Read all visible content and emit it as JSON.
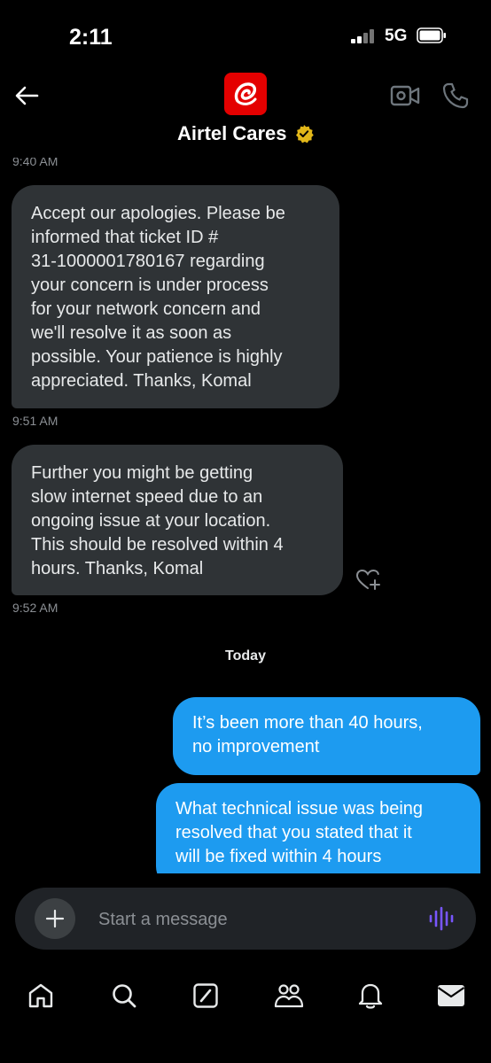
{
  "status_bar": {
    "time": "2:11",
    "network": "5G"
  },
  "header": {
    "contact_name": "Airtel Cares"
  },
  "messages": [
    {
      "type": "timestamp",
      "text": "9:40 AM"
    },
    {
      "type": "incoming",
      "lines": [
        "Accept our apologies. Please be",
        "informed that ticket ID #",
        "31-1000001780167 regarding",
        "your concern is under process",
        "for your network concern and",
        "we'll resolve it as soon as",
        "possible. Your patience is highly",
        "appreciated. Thanks, Komal"
      ]
    },
    {
      "type": "timestamp",
      "text": "9:51 AM"
    },
    {
      "type": "incoming",
      "lines": [
        "Further you might be getting",
        "slow internet speed due to an",
        "ongoing issue at your location.",
        "This should be resolved within 4",
        "hours. Thanks, Komal"
      ]
    },
    {
      "type": "timestamp",
      "text": "9:52 AM"
    },
    {
      "type": "divider",
      "text": "Today"
    },
    {
      "type": "outgoing",
      "lines": [
        "It’s been more than 40 hours,",
        "no improvement"
      ]
    },
    {
      "type": "outgoing",
      "lines": [
        "What technical issue was being",
        "resolved that you stated that it",
        "will be fixed within 4 hours"
      ]
    }
  ],
  "composer": {
    "placeholder": "Start a message"
  },
  "icons": {
    "back": "arrow-left-icon",
    "video": "video-camera-icon",
    "phone": "phone-icon",
    "react": "heart-plus-icon",
    "add": "plus-icon",
    "voice": "voice-waveform-icon",
    "nav": [
      "home-icon",
      "search-icon",
      "grok-icon",
      "communities-icon",
      "notifications-icon",
      "messages-icon"
    ]
  },
  "colors": {
    "background": "#000000",
    "incoming_bubble": "#2f3336",
    "outgoing_bubble": "#1d9bf0",
    "brand_red": "#e40000",
    "verified_gold": "#e2b719",
    "voice_accent": "#7856ff"
  }
}
